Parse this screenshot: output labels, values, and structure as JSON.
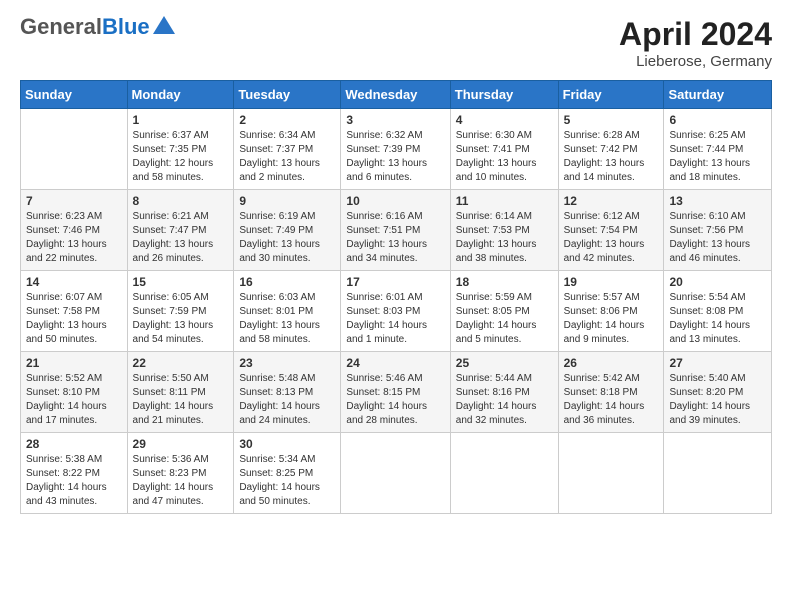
{
  "header": {
    "logo_general": "General",
    "logo_blue": "Blue",
    "title": "April 2024",
    "subtitle": "Lieberose, Germany"
  },
  "weekdays": [
    "Sunday",
    "Monday",
    "Tuesday",
    "Wednesday",
    "Thursday",
    "Friday",
    "Saturday"
  ],
  "weeks": [
    [
      {
        "day": "",
        "sunrise": "",
        "sunset": "",
        "daylight": ""
      },
      {
        "day": "1",
        "sunrise": "Sunrise: 6:37 AM",
        "sunset": "Sunset: 7:35 PM",
        "daylight": "Daylight: 12 hours and 58 minutes."
      },
      {
        "day": "2",
        "sunrise": "Sunrise: 6:34 AM",
        "sunset": "Sunset: 7:37 PM",
        "daylight": "Daylight: 13 hours and 2 minutes."
      },
      {
        "day": "3",
        "sunrise": "Sunrise: 6:32 AM",
        "sunset": "Sunset: 7:39 PM",
        "daylight": "Daylight: 13 hours and 6 minutes."
      },
      {
        "day": "4",
        "sunrise": "Sunrise: 6:30 AM",
        "sunset": "Sunset: 7:41 PM",
        "daylight": "Daylight: 13 hours and 10 minutes."
      },
      {
        "day": "5",
        "sunrise": "Sunrise: 6:28 AM",
        "sunset": "Sunset: 7:42 PM",
        "daylight": "Daylight: 13 hours and 14 minutes."
      },
      {
        "day": "6",
        "sunrise": "Sunrise: 6:25 AM",
        "sunset": "Sunset: 7:44 PM",
        "daylight": "Daylight: 13 hours and 18 minutes."
      }
    ],
    [
      {
        "day": "7",
        "sunrise": "Sunrise: 6:23 AM",
        "sunset": "Sunset: 7:46 PM",
        "daylight": "Daylight: 13 hours and 22 minutes."
      },
      {
        "day": "8",
        "sunrise": "Sunrise: 6:21 AM",
        "sunset": "Sunset: 7:47 PM",
        "daylight": "Daylight: 13 hours and 26 minutes."
      },
      {
        "day": "9",
        "sunrise": "Sunrise: 6:19 AM",
        "sunset": "Sunset: 7:49 PM",
        "daylight": "Daylight: 13 hours and 30 minutes."
      },
      {
        "day": "10",
        "sunrise": "Sunrise: 6:16 AM",
        "sunset": "Sunset: 7:51 PM",
        "daylight": "Daylight: 13 hours and 34 minutes."
      },
      {
        "day": "11",
        "sunrise": "Sunrise: 6:14 AM",
        "sunset": "Sunset: 7:53 PM",
        "daylight": "Daylight: 13 hours and 38 minutes."
      },
      {
        "day": "12",
        "sunrise": "Sunrise: 6:12 AM",
        "sunset": "Sunset: 7:54 PM",
        "daylight": "Daylight: 13 hours and 42 minutes."
      },
      {
        "day": "13",
        "sunrise": "Sunrise: 6:10 AM",
        "sunset": "Sunset: 7:56 PM",
        "daylight": "Daylight: 13 hours and 46 minutes."
      }
    ],
    [
      {
        "day": "14",
        "sunrise": "Sunrise: 6:07 AM",
        "sunset": "Sunset: 7:58 PM",
        "daylight": "Daylight: 13 hours and 50 minutes."
      },
      {
        "day": "15",
        "sunrise": "Sunrise: 6:05 AM",
        "sunset": "Sunset: 7:59 PM",
        "daylight": "Daylight: 13 hours and 54 minutes."
      },
      {
        "day": "16",
        "sunrise": "Sunrise: 6:03 AM",
        "sunset": "Sunset: 8:01 PM",
        "daylight": "Daylight: 13 hours and 58 minutes."
      },
      {
        "day": "17",
        "sunrise": "Sunrise: 6:01 AM",
        "sunset": "Sunset: 8:03 PM",
        "daylight": "Daylight: 14 hours and 1 minute."
      },
      {
        "day": "18",
        "sunrise": "Sunrise: 5:59 AM",
        "sunset": "Sunset: 8:05 PM",
        "daylight": "Daylight: 14 hours and 5 minutes."
      },
      {
        "day": "19",
        "sunrise": "Sunrise: 5:57 AM",
        "sunset": "Sunset: 8:06 PM",
        "daylight": "Daylight: 14 hours and 9 minutes."
      },
      {
        "day": "20",
        "sunrise": "Sunrise: 5:54 AM",
        "sunset": "Sunset: 8:08 PM",
        "daylight": "Daylight: 14 hours and 13 minutes."
      }
    ],
    [
      {
        "day": "21",
        "sunrise": "Sunrise: 5:52 AM",
        "sunset": "Sunset: 8:10 PM",
        "daylight": "Daylight: 14 hours and 17 minutes."
      },
      {
        "day": "22",
        "sunrise": "Sunrise: 5:50 AM",
        "sunset": "Sunset: 8:11 PM",
        "daylight": "Daylight: 14 hours and 21 minutes."
      },
      {
        "day": "23",
        "sunrise": "Sunrise: 5:48 AM",
        "sunset": "Sunset: 8:13 PM",
        "daylight": "Daylight: 14 hours and 24 minutes."
      },
      {
        "day": "24",
        "sunrise": "Sunrise: 5:46 AM",
        "sunset": "Sunset: 8:15 PM",
        "daylight": "Daylight: 14 hours and 28 minutes."
      },
      {
        "day": "25",
        "sunrise": "Sunrise: 5:44 AM",
        "sunset": "Sunset: 8:16 PM",
        "daylight": "Daylight: 14 hours and 32 minutes."
      },
      {
        "day": "26",
        "sunrise": "Sunrise: 5:42 AM",
        "sunset": "Sunset: 8:18 PM",
        "daylight": "Daylight: 14 hours and 36 minutes."
      },
      {
        "day": "27",
        "sunrise": "Sunrise: 5:40 AM",
        "sunset": "Sunset: 8:20 PM",
        "daylight": "Daylight: 14 hours and 39 minutes."
      }
    ],
    [
      {
        "day": "28",
        "sunrise": "Sunrise: 5:38 AM",
        "sunset": "Sunset: 8:22 PM",
        "daylight": "Daylight: 14 hours and 43 minutes."
      },
      {
        "day": "29",
        "sunrise": "Sunrise: 5:36 AM",
        "sunset": "Sunset: 8:23 PM",
        "daylight": "Daylight: 14 hours and 47 minutes."
      },
      {
        "day": "30",
        "sunrise": "Sunrise: 5:34 AM",
        "sunset": "Sunset: 8:25 PM",
        "daylight": "Daylight: 14 hours and 50 minutes."
      },
      {
        "day": "",
        "sunrise": "",
        "sunset": "",
        "daylight": ""
      },
      {
        "day": "",
        "sunrise": "",
        "sunset": "",
        "daylight": ""
      },
      {
        "day": "",
        "sunrise": "",
        "sunset": "",
        "daylight": ""
      },
      {
        "day": "",
        "sunrise": "",
        "sunset": "",
        "daylight": ""
      }
    ]
  ]
}
